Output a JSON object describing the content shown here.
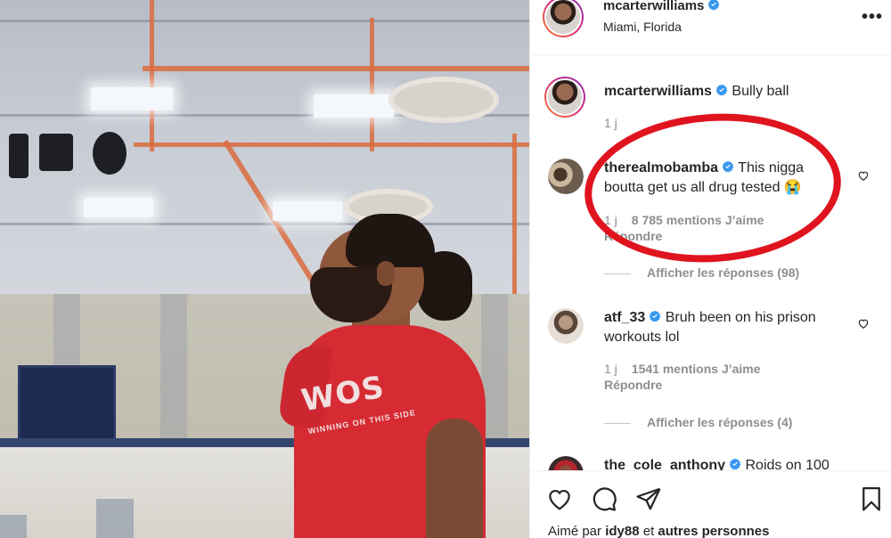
{
  "post": {
    "author": "mcarterwilliams",
    "location": "Miami, Florida",
    "caption": "Bully ball",
    "caption_time": "1 j",
    "photo_logo": "WOS",
    "photo_logo_sub": "WINNING ON THIS SIDE"
  },
  "comments": [
    {
      "username": "therealmobamba",
      "text": "This nigga boutta get us all drug tested 😭",
      "time": "1 j",
      "likes": "8 785 mentions J’aime",
      "reply": "Répondre",
      "view_replies": "Afficher les réponses (98)"
    },
    {
      "username": "atf_33",
      "text": "Bruh been on his prison workouts lol",
      "time": "1 j",
      "likes": "1541 mentions J’aime",
      "reply": "Répondre",
      "view_replies": "Afficher les réponses (4)"
    },
    {
      "username": "the_cole_anthony",
      "text": "Roids on 100"
    }
  ],
  "likes_summary": {
    "prefix": "Aimé par",
    "user": "idy88",
    "joiner": "et",
    "others": "autres personnes"
  },
  "icons": {
    "more": "more-options-icon",
    "verified": "verified-badge-icon",
    "heart": "heart-icon",
    "comment": "comment-icon",
    "share": "share-icon",
    "save": "bookmark-icon"
  },
  "colors": {
    "verified_blue": "#3897f0",
    "annotation_red": "#e0141e",
    "jersey_red": "#d62b33",
    "muted_text": "#8e8e8e"
  }
}
